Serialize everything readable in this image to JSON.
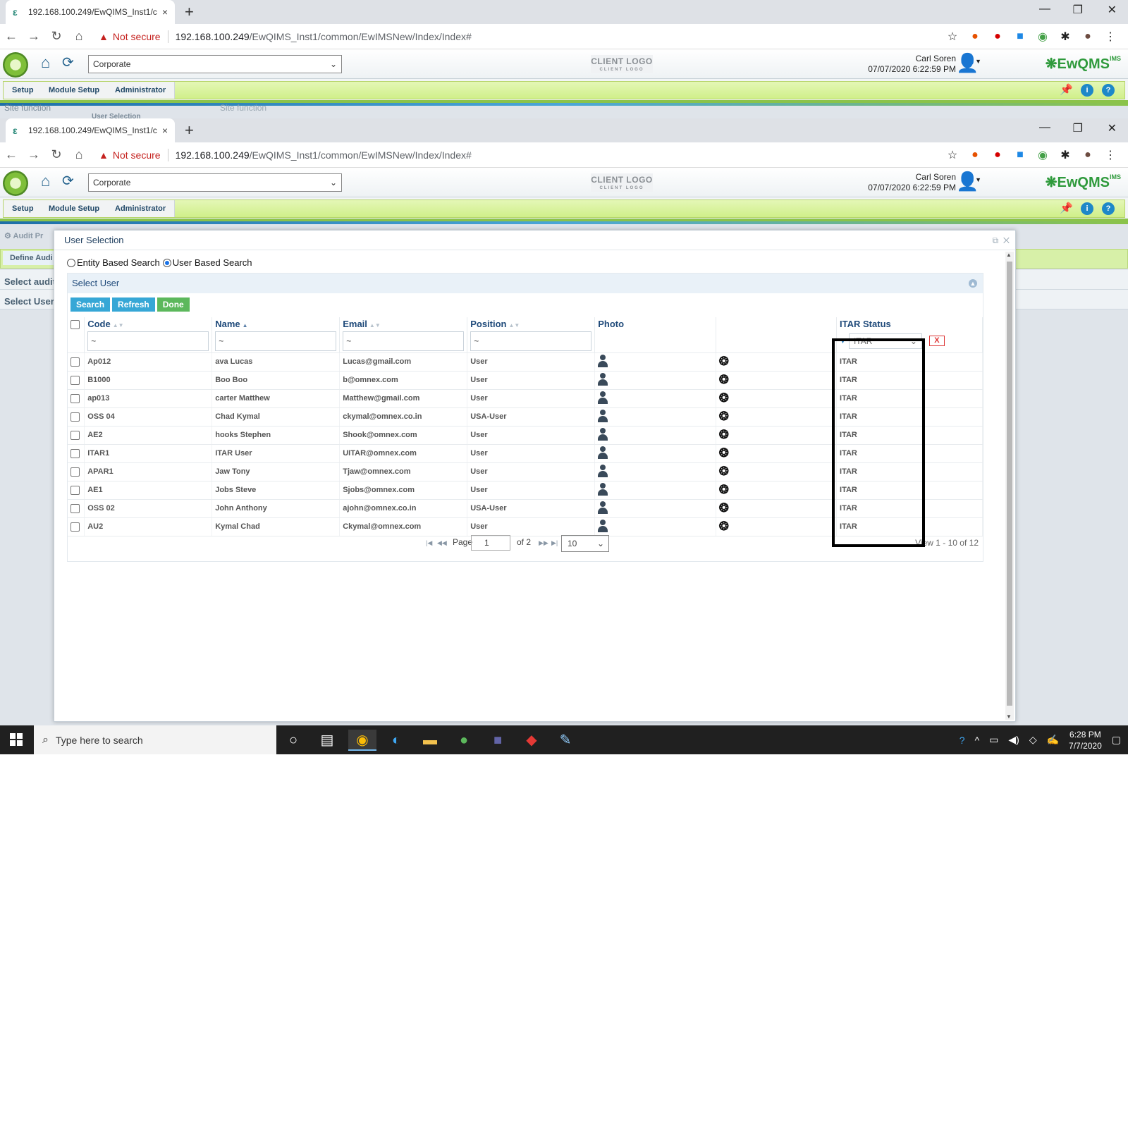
{
  "browser": {
    "tab_title": "192.168.100.249/EwQIMS_Inst1/c",
    "tab_close": "×",
    "new_tab": "+",
    "not_secure": "Not secure",
    "url_host": "192.168.100.249",
    "url_path": "/EwQIMS_Inst1/common/EwIMSNew/Index/Index#"
  },
  "app": {
    "site_select_value": "Corporate",
    "client_logo": "CLIENT LOGO",
    "client_logo_sub": "CLIENT LOGO",
    "user_name": "Carl Soren",
    "datetime": "07/07/2020 6:22:59 PM",
    "brand": "EwQMS",
    "brand_suffix": "IMS",
    "menu": [
      "Setup",
      "Module Setup",
      "Administrator"
    ]
  },
  "background": {
    "top_frag_1": "Site function",
    "top_frag_2": "User Selection",
    "top_frag_3": "Site function",
    "crumb": "Audit Pr",
    "tab": "Define Audi",
    "row1": "Select audit",
    "row2": "Select User"
  },
  "modal": {
    "title": "User Selection",
    "radio_entity": "Entity Based Search",
    "radio_user": "User Based Search",
    "panel_title": "Select User",
    "buttons": {
      "search": "Search",
      "refresh": "Refresh",
      "done": "Done"
    },
    "columns": [
      "Code",
      "Name",
      "Email",
      "Position",
      "Photo",
      "",
      "ITAR Status"
    ],
    "filter_placeholder": "~",
    "itar_filter_value": "ITAR",
    "clear_filter": "X",
    "rows": [
      {
        "code": "Ap012",
        "name": "ava Lucas",
        "email": "Lucas@gmail.com",
        "position": "User",
        "itar": "ITAR"
      },
      {
        "code": "B1000",
        "name": "Boo Boo",
        "email": "b@omnex.com",
        "position": "User",
        "itar": "ITAR"
      },
      {
        "code": "ap013",
        "name": "carter Matthew",
        "email": "Matthew@gmail.com",
        "position": "User",
        "itar": "ITAR"
      },
      {
        "code": "OSS 04",
        "name": "Chad Kymal",
        "email": "ckymal@omnex.co.in",
        "position": "USA-User",
        "itar": "ITAR"
      },
      {
        "code": "AE2",
        "name": "hooks Stephen",
        "email": "Shook@omnex.com",
        "position": "User",
        "itar": "ITAR"
      },
      {
        "code": "ITAR1",
        "name": "ITAR User",
        "email": "UITAR@omnex.com",
        "position": "User",
        "itar": "ITAR"
      },
      {
        "code": "APAR1",
        "name": "Jaw Tony",
        "email": "Tjaw@omnex.com",
        "position": "User",
        "itar": "ITAR"
      },
      {
        "code": "AE1",
        "name": "Jobs Steve",
        "email": "Sjobs@omnex.com",
        "position": "User",
        "itar": "ITAR"
      },
      {
        "code": "OSS 02",
        "name": "John Anthony",
        "email": "ajohn@omnex.co.in",
        "position": "USA-User",
        "itar": "ITAR"
      },
      {
        "code": "AU2",
        "name": "Kymal Chad",
        "email": "Ckymal@omnex.com",
        "position": "User",
        "itar": "ITAR"
      }
    ],
    "pager": {
      "page_label": "Page",
      "page_value": "1",
      "of_label": "of 2",
      "page_size": "10",
      "view_text": "View 1 - 10 of 12"
    }
  },
  "taskbar": {
    "search_placeholder": "Type here to search",
    "time": "6:28 PM",
    "date": "7/7/2020"
  }
}
